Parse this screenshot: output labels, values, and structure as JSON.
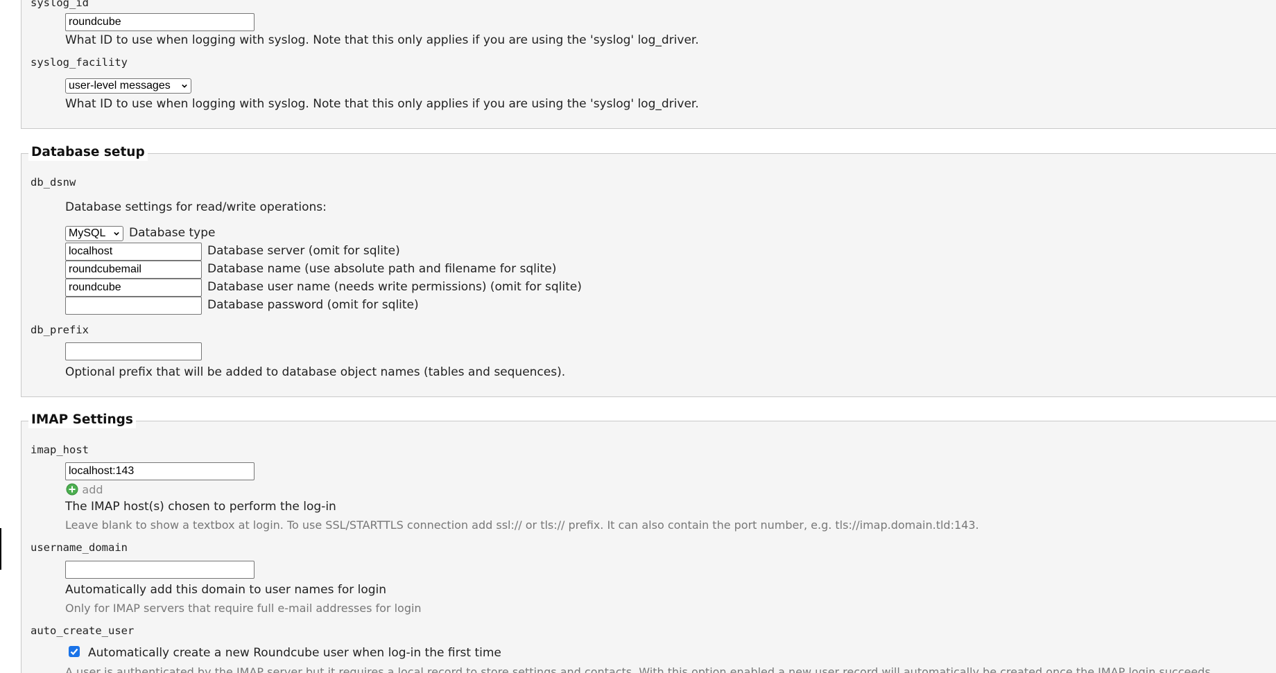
{
  "general": {
    "syslog_id": {
      "name": "syslog_id",
      "value": "roundcube",
      "description": "What ID to use when logging with syslog. Note that this only applies if you are using the 'syslog' log_driver."
    },
    "syslog_facility": {
      "name": "syslog_facility",
      "selected": "user-level messages",
      "description": "What ID to use when logging with syslog. Note that this only applies if you are using the 'syslog' log_driver."
    }
  },
  "database": {
    "legend": "Database setup",
    "db_dsnw": {
      "name": "db_dsnw",
      "intro": "Database settings for read/write operations:",
      "type_selected": "MySQL",
      "type_label": "Database type",
      "server_value": "localhost",
      "server_label": "Database server (omit for sqlite)",
      "dbname_value": "roundcubemail",
      "dbname_label": "Database name (use absolute path and filename for sqlite)",
      "user_value": "roundcube",
      "user_label": "Database user name (needs write permissions) (omit for sqlite)",
      "password_value": "",
      "password_label": "Database password (omit for sqlite)"
    },
    "db_prefix": {
      "name": "db_prefix",
      "value": "",
      "description": "Optional prefix that will be added to database object names (tables and sequences)."
    }
  },
  "imap": {
    "legend": "IMAP Settings",
    "imap_host": {
      "name": "imap_host",
      "value": "localhost:143",
      "add_label": "add",
      "description": "The IMAP host(s) chosen to perform the log-in",
      "hint": "Leave blank to show a textbox at login. To use SSL/STARTTLS connection add ssl:// or tls:// prefix. It can also contain the port number, e.g. tls://imap.domain.tld:143."
    },
    "username_domain": {
      "name": "username_domain",
      "value": "",
      "description": "Automatically add this domain to user names for login",
      "hint": "Only for IMAP servers that require full e-mail addresses for login"
    },
    "auto_create_user": {
      "name": "auto_create_user",
      "checked": true,
      "label": "Automatically create a new Roundcube user when log-in the first time",
      "hint": "A user is authenticated by the IMAP server but it requires a local record to store settings and contacts. With this option enabled a new user record will automatically be created once the IMAP login succeeds."
    }
  },
  "colors": {
    "section_bg": "#f5f5f5",
    "border": "#c9c9c9",
    "hint_text": "#777777",
    "checkbox_accent": "#1a73e8",
    "add_icon": "#4caf50"
  }
}
